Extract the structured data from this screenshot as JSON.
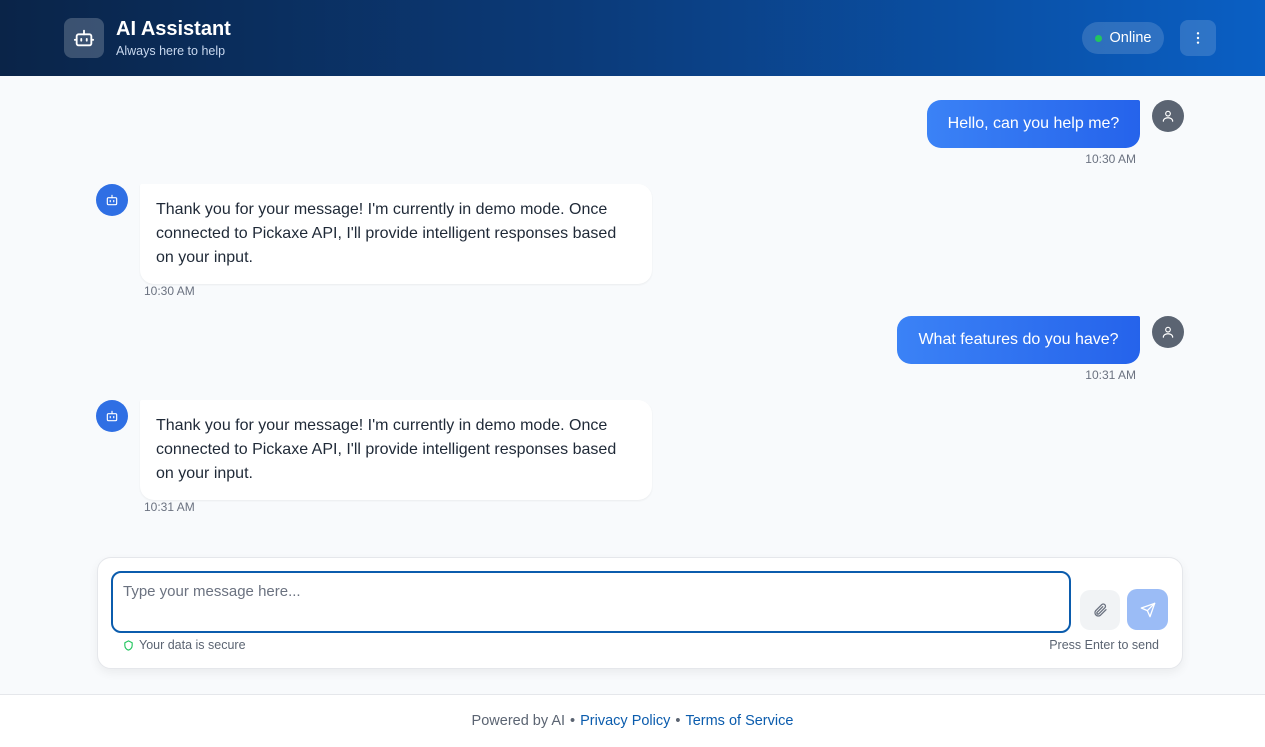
{
  "header": {
    "title": "AI Assistant",
    "subtitle": "Always here to help",
    "status": "Online",
    "logo_icon": "robot-icon",
    "menu_icon": "more-vertical-icon",
    "status_color": "#22c55e"
  },
  "messages": [
    {
      "role": "user",
      "text": "Hello, can you help me?",
      "time": "10:30 AM"
    },
    {
      "role": "assistant",
      "text": "Thank you for your message! I'm currently in demo mode. Once connected to Pickaxe API, I'll provide intelligent responses based on your input.",
      "time": "10:30 AM"
    },
    {
      "role": "user",
      "text": "What features do you have?",
      "time": "10:31 AM"
    },
    {
      "role": "assistant",
      "text": "Thank you for your message! I'm currently in demo mode. Once connected to Pickaxe API, I'll provide intelligent responses based on your input.",
      "time": "10:31 AM"
    }
  ],
  "composer": {
    "placeholder": "Type your message here...",
    "secure_note": "Your data is secure",
    "hint": "Press Enter to send",
    "attach_icon": "paperclip-icon",
    "send_icon": "send-icon"
  },
  "footer": {
    "powered": "Powered by AI",
    "privacy": "Privacy Policy",
    "terms": "Terms of Service",
    "separator": "•"
  },
  "colors": {
    "accent": "#2563eb",
    "link": "#0b5cad",
    "background": "#f8fafc"
  }
}
